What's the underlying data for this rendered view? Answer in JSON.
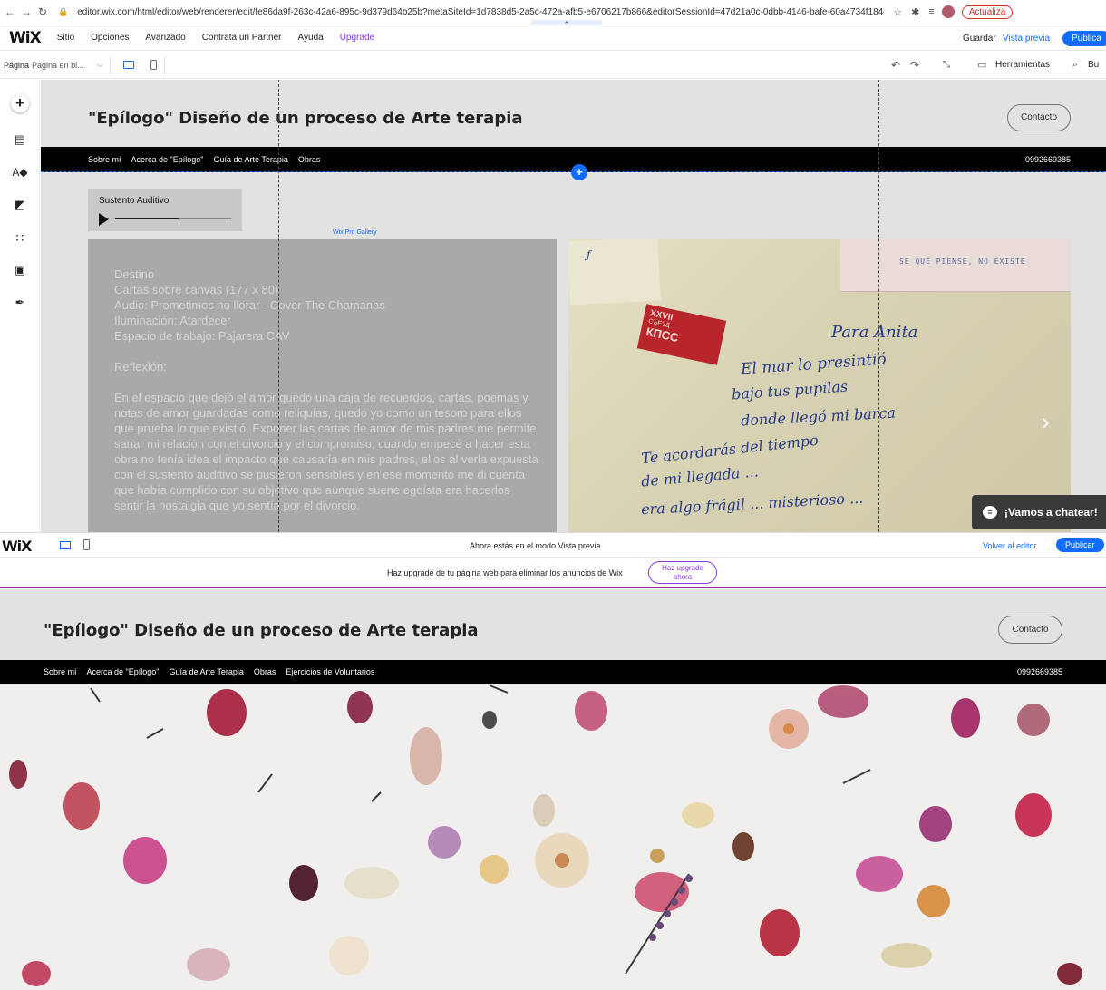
{
  "browser": {
    "url": "editor.wix.com/html/editor/web/renderer/edit/fe86da9f-263c-42a6-895c-9d379d64b25b?metaSiteId=1d7838d5-2a5c-472a-afb5-e6706217b866&editorSessionId=47d21a0c-0dbb-4146-bafe-60a4734f184d&onboardin...",
    "update_label": "Actualiza"
  },
  "editor": {
    "menu": [
      "Sitio",
      "Opciones",
      "Avanzado",
      "Contrata un Partner",
      "Ayuda",
      "Upgrade"
    ],
    "save_label": "Guardar",
    "preview_label": "Vista previa",
    "publish_label": "Publica",
    "page_prefix": "Página",
    "page_name": "Página en bl...",
    "tools_label": "Herramientas",
    "search_label": "Bu"
  },
  "site_editor": {
    "title": "\"Epílogo\" Diseño de un proceso de Arte terapia",
    "contact_label": "Contacto",
    "nav": [
      "Sobre mí",
      "Acerca de \"Epílogo\"",
      "Guía de Arte Terapia",
      "Obras"
    ],
    "phone": "0992669385",
    "audio_title": "Sustento Auditivo",
    "gallery_tag": "Wix Pro Gallery",
    "text_lines": [
      "Destino",
      "Cartas sobre canvas (177 x 80)",
      "Audio: Prometimos no llorar - Cover The Chamanas",
      "Iluminación: Atardecer",
      "Espacio de trabajo: Pajarera CAV"
    ],
    "reflection_label": "Reflexión:",
    "reflection": "En el espacio que dejó el amor quedó una caja de recuerdos, cartas, poemas y notas de amor guardadas como reliquias, quedó yo como un tesoro para ellos que prueba lo que existió. Exponer las cartas de amor de mis padres me permite sanar mi relación con el divorcio y el compromiso, cuando empecé a hacer esta obra no tenía idea el impacto que causaría en mis padres, ellos al verla expuesta con el sustento auditivo se pusieron sensibles y en ese momento me di cuenta que había cumplido con su objetivo que aunque suene egoísta era hacerlos sentir la nostalgia que yo sentía por el divorcio.",
    "letter": {
      "stamp_top": "XXVII",
      "stamp_mid": "СЪЕЗД",
      "stamp_bottom": "КПСС",
      "header_right": "SE QUE PIENSE, NO EXISTE",
      "lines": [
        "Para Anita",
        "El mar lo presintió",
        "bajo tus pupilas",
        "donde llegó mi barca",
        "Te acordarás del tiempo",
        "de mi llegada ...",
        "era algo frágil ... misterioso ..."
      ]
    },
    "chat_label": "¡Vamos a chatear!"
  },
  "preview": {
    "mode_text": "Ahora estás en el modo Vista previa",
    "back_label": "Volver al editor",
    "publish_label": "Publicar",
    "upgrade_text": "Haz upgrade de tu página web para eliminar los anuncios de Wix",
    "upgrade_btn_1": "Haz upgrade",
    "upgrade_btn_2": "ahora"
  },
  "site_preview": {
    "title": "\"Epílogo\" Diseño de un proceso de Arte terapia",
    "contact_label": "Contacto",
    "nav": [
      "Sobre mí",
      "Acerca de \"Epílogo\"",
      "Guía de Arte Terapia",
      "Obras",
      "Ejercicios de Voluntarios"
    ],
    "phone": "0992669385"
  },
  "audio": {
    "progress": 0.55
  },
  "colors": {
    "wix_blue": "#116dff",
    "upgrade_purple": "#8a3bd6",
    "navbar": "#000000",
    "canvas": "#e2e2e2"
  }
}
